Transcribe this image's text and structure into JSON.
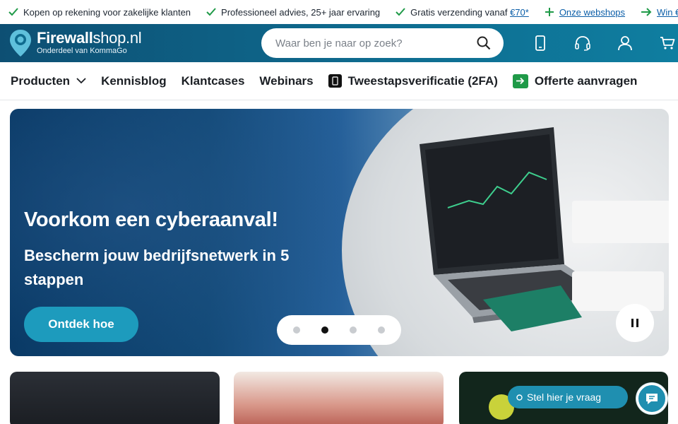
{
  "usp": {
    "items": [
      {
        "text": "Kopen op rekening voor zakelijke klanten"
      },
      {
        "text": "Professioneel advies, 25+ jaar ervaring"
      },
      {
        "text": "Gratis verzending vanaf ",
        "link": "€70*"
      },
      {
        "link": "Onze webshops"
      },
      {
        "link": "Win €"
      }
    ]
  },
  "logo": {
    "bold": "Firewall",
    "rest": "shop.nl",
    "sub": "Onderdeel van KommaGo"
  },
  "search": {
    "placeholder": "Waar ben je naar op zoek?"
  },
  "header_icons": [
    "mobile-icon",
    "headset-icon",
    "account-icon",
    "cart-icon"
  ],
  "nav": {
    "products": "Producten",
    "blog": "Kennisblog",
    "cases": "Klantcases",
    "webinars": "Webinars",
    "twofa": "Tweestapsverificatie (2FA)",
    "quote": "Offerte aanvragen"
  },
  "hero": {
    "title": "Voorkom een cyberaanval!",
    "subtitle": "Bescherm jouw bedrijfsnetwerk in 5 stappen",
    "cta": "Ontdek hoe",
    "slides_count": 4,
    "active_slide": 2
  },
  "chat": {
    "label": "Stel hier je vraag"
  },
  "colors": {
    "header": "#0e6b8f",
    "accent": "#1d9bbd",
    "check": "#1f9a48"
  }
}
